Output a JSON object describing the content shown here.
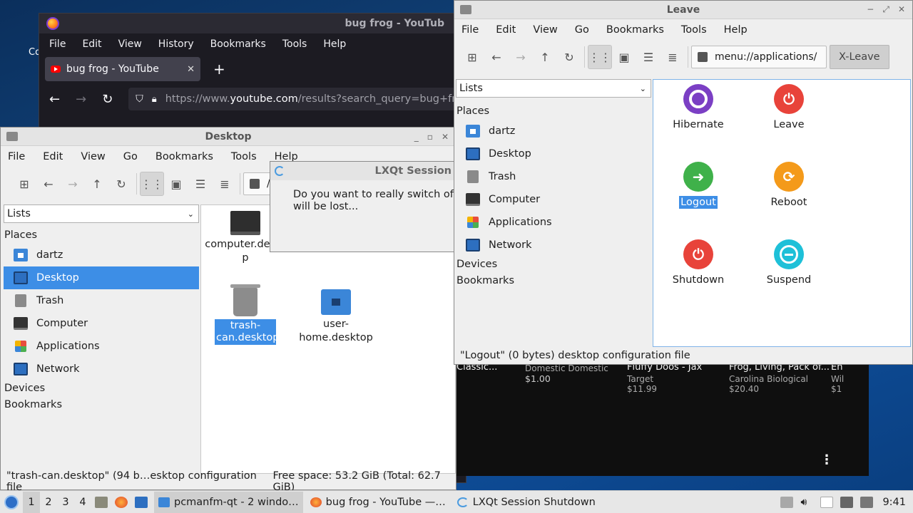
{
  "desktop": {
    "label": "Co"
  },
  "firefox": {
    "title": "bug frog - YouTub",
    "menu": [
      "File",
      "Edit",
      "View",
      "History",
      "Bookmarks",
      "Tools",
      "Help"
    ],
    "tab_title": "bug frog - YouTube",
    "tab_close": "✕",
    "new_tab": "+",
    "url_prefix": "https://www.",
    "url_host": "youtube.com",
    "url_rest": "/results?search_query=bug+fr"
  },
  "youtube": {
    "items": [
      {
        "title": "Classic...",
        "sub": "",
        "price": ""
      },
      {
        "title": "Domestic Domestic",
        "sub": "",
        "price": "$1.00"
      },
      {
        "title": "Fluffy Doos - Jax",
        "sub": "Target",
        "price": "$11.99"
      },
      {
        "title": "Frog, Living, Pack of...",
        "sub": "Carolina Biological",
        "price": "$20.40"
      },
      {
        "title": "En",
        "sub": "Wil",
        "price": "$1"
      }
    ],
    "more": "⋮"
  },
  "fm": {
    "title": "Desktop",
    "menu": [
      "File",
      "Edit",
      "View",
      "Go",
      "Bookmarks",
      "Tools",
      "Help"
    ],
    "path": "/",
    "side_combo": "Lists",
    "places_label": "Places",
    "places": [
      {
        "label": "dartz",
        "icon": "home"
      },
      {
        "label": "Desktop",
        "icon": "desktop",
        "selected": true
      },
      {
        "label": "Trash",
        "icon": "trash"
      },
      {
        "label": "Computer",
        "icon": "computer"
      },
      {
        "label": "Applications",
        "icon": "apps"
      },
      {
        "label": "Network",
        "icon": "network"
      }
    ],
    "devices_label": "Devices",
    "bookmarks_label": "Bookmarks",
    "files": [
      {
        "name1": "computer.desto",
        "name2": "p"
      },
      {
        "name1": "trash-",
        "name2": "can.desktop"
      },
      {
        "name1": "user-",
        "name2": "home.desktop"
      }
    ],
    "status_left": "\"trash-can.desktop\" (94 b…esktop configuration file",
    "status_free": "Free space: 53.2 GiB (Total: 62.7 GiB)"
  },
  "dialog": {
    "title": "LXQt Session",
    "line1": "Do you want to really switch off y",
    "line2": "will be lost..."
  },
  "leave": {
    "title": "Leave",
    "menu": [
      "File",
      "Edit",
      "View",
      "Go",
      "Bookmarks",
      "Tools",
      "Help"
    ],
    "path": "menu://applications/",
    "xleave": "X-Leave",
    "side_combo": "Lists",
    "places_label": "Places",
    "places": [
      {
        "label": "dartz",
        "icon": "home"
      },
      {
        "label": "Desktop",
        "icon": "desktop"
      },
      {
        "label": "Trash",
        "icon": "trash"
      },
      {
        "label": "Computer",
        "icon": "computer"
      },
      {
        "label": "Applications",
        "icon": "apps"
      },
      {
        "label": "Network",
        "icon": "network"
      }
    ],
    "devices_label": "Devices",
    "bookmarks_label": "Bookmarks",
    "actions": [
      {
        "label": "Hibernate",
        "color": "#7b3fc4"
      },
      {
        "label": "Leave",
        "color": "#e8433a"
      },
      {
        "label": "Logout",
        "color": "#3fb14a",
        "selected": true
      },
      {
        "label": "Reboot",
        "color": "#f49a1a"
      },
      {
        "label": "Shutdown",
        "color": "#e8433a"
      },
      {
        "label": "Suspend",
        "color": "#1ec0d8"
      }
    ],
    "status": "\"Logout\" (0 bytes) desktop configuration file"
  },
  "taskbar": {
    "workspaces": [
      "1",
      "2",
      "3",
      "4"
    ],
    "tasks": [
      {
        "label": "pcmanfm-qt - 2 windo…",
        "icon": "folder-icon"
      },
      {
        "label": "bug frog - YouTube —…",
        "icon": "firefox-icon"
      },
      {
        "label": "LXQt Session Shutdown",
        "icon": "lxqt-icon"
      }
    ],
    "clock": "9:41"
  }
}
